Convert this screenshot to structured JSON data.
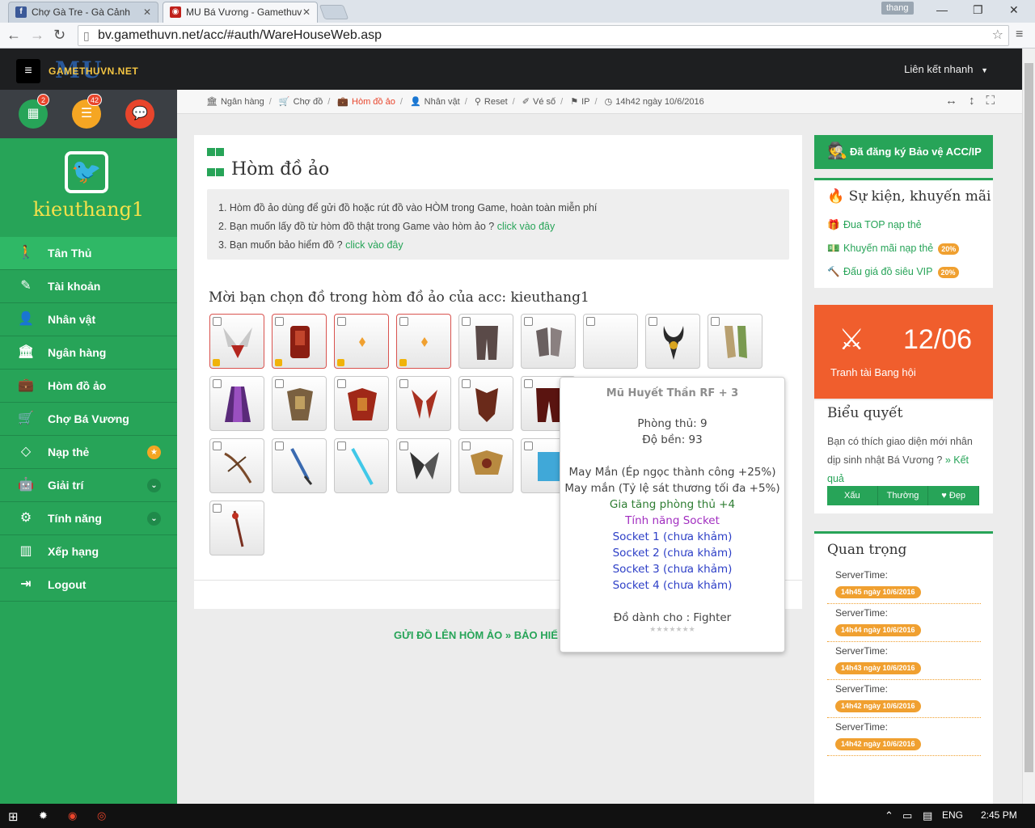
{
  "browser": {
    "tabs": [
      {
        "label": "Chợ Gà Tre - Gà Cảnh",
        "icon": "facebook-icon"
      },
      {
        "label": "MU Bá Vương - Gamethuv",
        "icon": "mu-icon"
      }
    ],
    "user": "thang",
    "url": "bv.gamethuvn.net/acc/#auth/WareHouseWeb.asp"
  },
  "header": {
    "logo_top": "MU",
    "logo_text": "GAMETHUVN.NET",
    "quick_link": "Liên kết nhanh"
  },
  "sidebar": {
    "badges": [
      "2",
      "42"
    ],
    "username": "kieuthang1",
    "items": [
      {
        "label": "Tân Thủ"
      },
      {
        "label": "Tài khoản"
      },
      {
        "label": "Nhân vật"
      },
      {
        "label": "Ngân hàng"
      },
      {
        "label": "Hòm đồ ảo"
      },
      {
        "label": "Chợ Bá Vương"
      },
      {
        "label": "Nạp thẻ"
      },
      {
        "label": "Giải trí"
      },
      {
        "label": "Tính năng"
      },
      {
        "label": "Xếp hạng"
      },
      {
        "label": "Logout"
      }
    ]
  },
  "breadcrumb": {
    "items": [
      "Ngân hàng",
      "Chợ đồ",
      "Hòm đồ ảo",
      "Nhân vật",
      "Reset",
      "Vé số",
      "IP"
    ],
    "time": "14h42 ngày 10/6/2016"
  },
  "main": {
    "title": "Hòm đồ ảo",
    "notes": [
      {
        "text": "1. Hòm đồ ảo dùng để gửi đồ hoặc rút đồ vào HÒM trong Game, hoàn toàn miễn phí",
        "link": ""
      },
      {
        "text": "2. Bạn muốn lấy đồ từ hòm đồ thật trong Game vào hòm ảo ? ",
        "link": "click vào đây"
      },
      {
        "text": "3. Bạn muốn bảo hiểm đồ ? ",
        "link": "click vào đây"
      }
    ],
    "choose_label": "Mời bạn chọn đồ trong hòm đồ ảo của acc: kieuthang1",
    "bottom_links": "GỬI ĐỒ LÊN HÒM ẢO  »  BẢO HIỂ"
  },
  "tooltip": {
    "name": "Mũ Huyết Thần RF + 3",
    "lines": [
      {
        "text": "",
        "color": "grey"
      },
      {
        "text": "Phòng thủ: 9",
        "color": "grey"
      },
      {
        "text": "Độ bền: 93",
        "color": "grey"
      },
      {
        "text": "",
        "color": "grey"
      },
      {
        "text": "May Mắn (Ép ngọc thành công +25%)",
        "color": "grey"
      },
      {
        "text": "May mắn (Tỷ lệ sát thương tối đa +5%)",
        "color": "grey"
      },
      {
        "text": "Gia tăng phòng thủ +4",
        "color": "green"
      },
      {
        "text": "Tính năng Socket",
        "color": "purple"
      },
      {
        "text": "Socket 1 (chưa khảm)",
        "color": "blue"
      },
      {
        "text": "Socket 2 (chưa khảm)",
        "color": "blue"
      },
      {
        "text": "Socket 3 (chưa khảm)",
        "color": "blue"
      },
      {
        "text": "Socket 4 (chưa khảm)",
        "color": "blue"
      },
      {
        "text": "",
        "color": "grey"
      },
      {
        "text": "Đồ dành cho : Fighter",
        "color": "grey"
      }
    ],
    "stars": "★★★★★★★"
  },
  "right": {
    "account_protect": "Đã đăng ký Bảo vệ ACC/IP",
    "event_title": "Sự kiện, khuyến mãi",
    "events": [
      {
        "label": "Đua TOP nạp thẻ",
        "pct": ""
      },
      {
        "label": "Khuyến mãi nạp thẻ",
        "pct": "20%"
      },
      {
        "label": "Đấu giá đồ siêu VIP",
        "pct": "20%"
      }
    ],
    "guild_date": "12/06",
    "guild_label": "Tranh tài Bang hội",
    "vote_title": "Biểu quyết",
    "vote_text": "Bạn có thích giao diện mới nhân dịp sinh nhật Bá Vương ? ",
    "vote_link": "» Kết quả",
    "vote_buttons": [
      "Xấu",
      "Thường",
      "♥ Đẹp"
    ],
    "important_title": "Quan trọng",
    "server_times": [
      {
        "label": "ServerTime:",
        "time": "14h45 ngày 10/6/2016"
      },
      {
        "label": "ServerTime:",
        "time": "14h44 ngày 10/6/2016"
      },
      {
        "label": "ServerTime:",
        "time": "14h43 ngày 10/6/2016"
      },
      {
        "label": "ServerTime:",
        "time": "14h42 ngày 10/6/2016"
      },
      {
        "label": "ServerTime:",
        "time": "14h42 ngày 10/6/2016"
      }
    ]
  },
  "taskbar": {
    "lang": "ENG",
    "clock": "2:45 PM"
  },
  "colors": {
    "green": "#27a458",
    "orange": "#f05e2d",
    "red_accent": "#e8452c",
    "badge_orange": "#f0a030"
  }
}
